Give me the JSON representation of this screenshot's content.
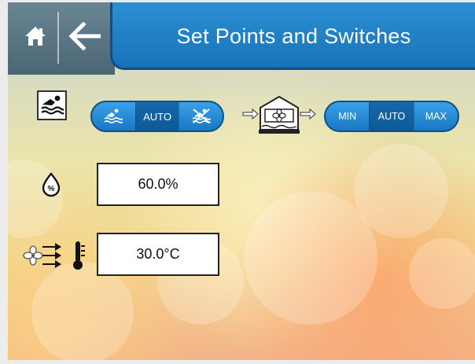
{
  "header": {
    "title": "Set Points and Switches",
    "home_icon": "home-icon",
    "back_icon": "back-arrow-icon"
  },
  "colors": {
    "header_blue": "#1873b6",
    "header_gray": "#55707e",
    "pill_blue": "#2a8ad2",
    "pill_selected": "#0e5a98"
  },
  "pool_mode": {
    "icon": "swimmer-icon",
    "options": [
      "pool-cover-on-icon",
      "AUTO",
      "pool-cover-off-icon"
    ],
    "auto_label": "AUTO",
    "selected": "AUTO"
  },
  "fan_mode": {
    "icon": "dehumidifier-unit-icon",
    "min_label": "MIN",
    "auto_label": "AUTO",
    "max_label": "MAX",
    "selected": "AUTO"
  },
  "humidity": {
    "icon": "humidity-drop-icon",
    "value": "60.0%"
  },
  "air_temperature": {
    "icon": "fan-airflow-thermometer-icon",
    "value": "30.0°C"
  }
}
